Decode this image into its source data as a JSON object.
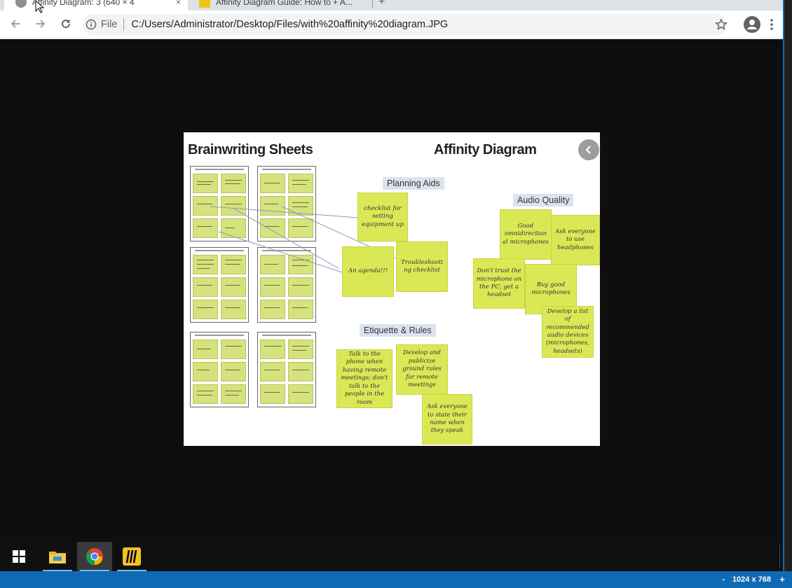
{
  "browser": {
    "tabs": [
      {
        "title": "Affinity Diagram: 3 (640 × 4",
        "close": "×"
      },
      {
        "title": "Affinity Diagram Guide: How to + A...",
        "close": "×"
      }
    ],
    "new_tab": "+",
    "omnibox": {
      "scheme_chip": "File",
      "url": "C:/Users/Administrator/Desktop/Files/with%20affinity%20diagram.JPG"
    },
    "icons": [
      "back-icon",
      "forward-icon",
      "reload-icon",
      "info-icon",
      "star-icon",
      "profile-icon",
      "menu-icon"
    ]
  },
  "slide": {
    "title_left": "Brainwriting Sheets",
    "title_right": "Affinity Diagram",
    "groups": {
      "planning": "Planning Aids",
      "audio": "Audio Quality",
      "etiquette": "Etiquette & Rules"
    },
    "notes": {
      "checklist": "checklist for setting equipment up",
      "agenda": "An agenda!!!",
      "troubleshooting": "Troubleshooti ng checklist",
      "omni": "Good omnidirection al microphones",
      "headphones": "Ask everyone to use headphones",
      "dont_trust": "Don't trust the microphone on the PC; get a headset",
      "buy_good": "Buy good microphones",
      "develop_list": "Develop a list of recommended audio devices (microphones, headsets)",
      "talk_phone": "Talk to the phone when having remote meetings; don't talk to the people in the room",
      "ground_rules": "Develop and publicize ground rules for remote meetings",
      "state_name": "Ask everyone to state their name when they speak"
    }
  },
  "taskbar": {
    "apps": [
      "windows-start-icon",
      "file-explorer-icon",
      "chrome-icon",
      "miro-icon"
    ]
  },
  "status": {
    "minus": "-",
    "resolution": "1024 x 768",
    "plus": "+"
  },
  "colors": {
    "note": "#dbe856",
    "group_header": "#dde3ee",
    "taskbar": "#101010",
    "status_strip": "#0f6ab4"
  }
}
